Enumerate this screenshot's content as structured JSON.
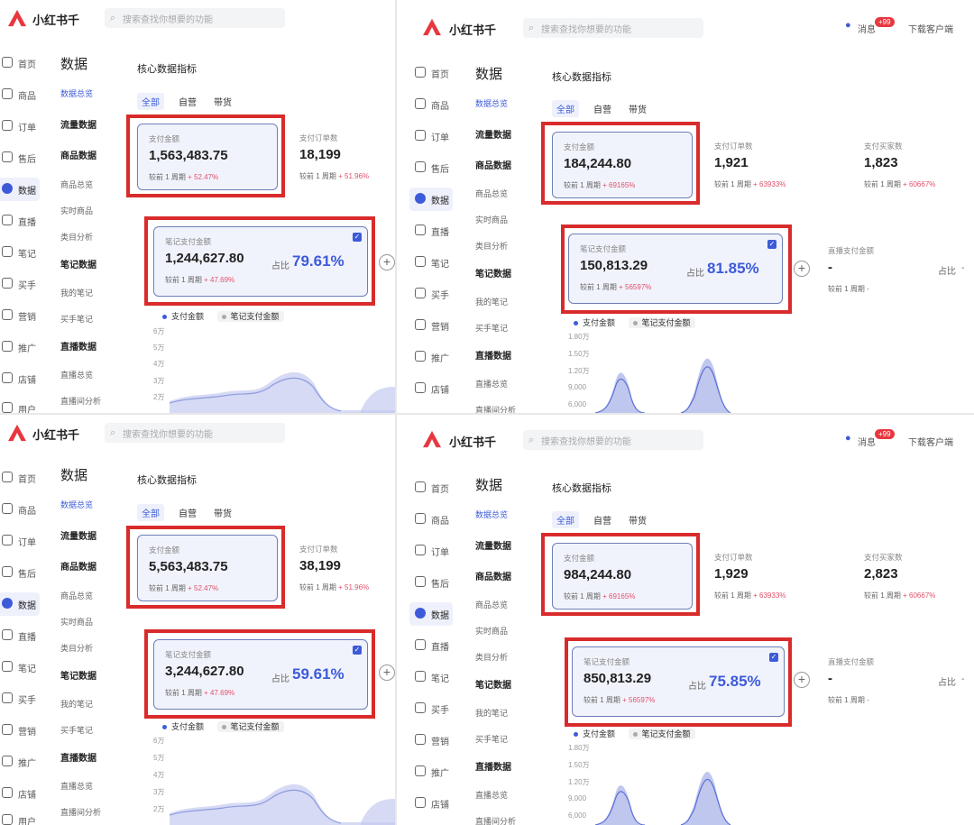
{
  "app": {
    "brand": "小红书千",
    "search_placeholder": "搜索查找你想要的功能",
    "messages": "消息",
    "message_badge": "+99",
    "download": "下载客户端"
  },
  "nav": [
    "首页",
    "商品",
    "订单",
    "售后",
    "数据",
    "直播",
    "笔记",
    "买手",
    "营销",
    "推广",
    "店铺",
    "用户"
  ],
  "subnav": {
    "title": "数据",
    "items": [
      "数据总览",
      "流量数据",
      "商品数据",
      "商品总览",
      "实时商品",
      "类目分析",
      "笔记数据",
      "我的笔记",
      "买手笔记",
      "直播数据",
      "直播总览",
      "直播间分析"
    ]
  },
  "section": {
    "title": "核心数据指标",
    "tabs": [
      "全部",
      "自营",
      "带货"
    ]
  },
  "labels": {
    "pay_amount": "支付金额",
    "pay_orders": "支付订单数",
    "pay_buyers": "支付买家数",
    "note_pay_amount": "笔记支付金额",
    "live_pay_amount": "直播支付金额",
    "compare": "较前 1 周期",
    "ratio": "占比",
    "legend_pay": "支付金额",
    "legend_note": "笔记支付金额",
    "dash": "-"
  },
  "colors": {
    "accent": "#3d5bd9",
    "highlight_box": "#d92b2b",
    "pct_up": "#e0506a"
  },
  "panels": [
    {
      "pay_amount": "1,563,483.75",
      "pay_change": "+ 52.47%",
      "orders": "18,199",
      "orders_change": "+ 51.96%",
      "note_amount": "1,244,627.80",
      "note_change": "+ 47.69%",
      "ratio": "79.61%",
      "y_ticks": [
        "6万",
        "5万",
        "4万",
        "3万",
        "2万"
      ]
    },
    {
      "pay_amount": "184,244.80",
      "pay_change": "+ 69165%",
      "orders": "1,921",
      "orders_change": "+ 63933%",
      "buyers": "1,823",
      "buyers_change": "+ 60667%",
      "note_amount": "150,813.29",
      "note_change": "+ 56597%",
      "ratio": "81.85%",
      "live_dash": "-",
      "live_change": "-",
      "y_ticks": [
        "1.80万",
        "1.50万",
        "1.20万",
        "9,000",
        "6,000"
      ]
    },
    {
      "pay_amount": "5,563,483.75",
      "pay_change": "+ 52.47%",
      "orders": "38,199",
      "orders_change": "+ 51.96%",
      "note_amount": "3,244,627.80",
      "note_change": "+ 47.69%",
      "ratio": "59.61%",
      "y_ticks": [
        "6万",
        "5万",
        "4万",
        "3万",
        "2万"
      ]
    },
    {
      "pay_amount": "984,244.80",
      "pay_change": "+ 69165%",
      "orders": "1,929",
      "orders_change": "+ 63933%",
      "buyers": "2,823",
      "buyers_change": "+ 60667%",
      "note_amount": "850,813.29",
      "note_change": "+ 56597%",
      "ratio": "75.85%",
      "live_dash": "-",
      "live_change": "-",
      "y_ticks": [
        "1.80万",
        "1.50万",
        "1.20万",
        "9,000",
        "6,000"
      ]
    }
  ]
}
